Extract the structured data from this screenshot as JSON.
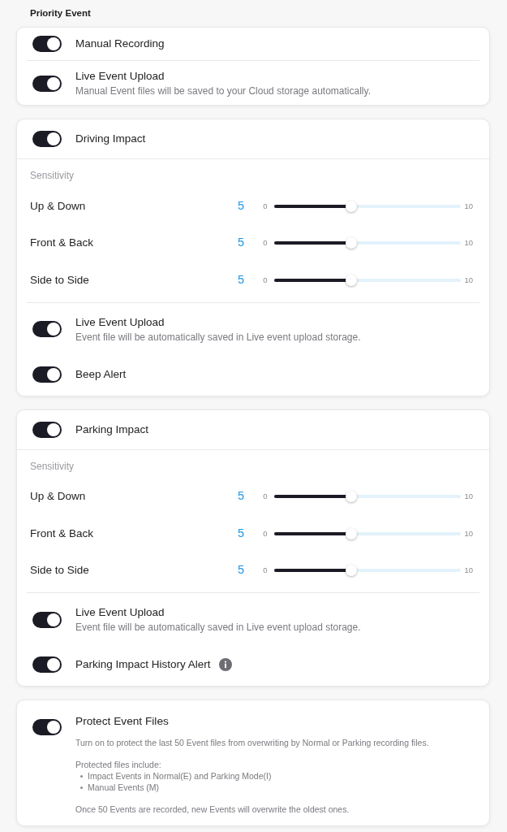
{
  "section_title": "Priority Event",
  "cards": [
    {
      "kind": "list",
      "rows": [
        {
          "label": "Manual Recording",
          "on": true,
          "info": false
        },
        {
          "label": "Live Event Upload",
          "description": "Manual Event files will be saved to your Cloud storage automatically.",
          "on": true,
          "info": false
        }
      ]
    },
    {
      "kind": "impact",
      "header": {
        "label": "Driving Impact",
        "on": true
      },
      "sensitivity": {
        "title": "Sensitivity",
        "sliders": [
          {
            "label": "Up & Down",
            "reading": "5",
            "min": "0",
            "max": "10",
            "level": 0.41
          },
          {
            "label": "Front & Back",
            "reading": "5",
            "min": "0",
            "max": "10",
            "level": 0.41
          },
          {
            "label": "Side to Side",
            "reading": "5",
            "min": "0",
            "max": "10",
            "level": 0.41
          }
        ]
      },
      "rows": [
        {
          "label": "Live Event Upload",
          "description": "Event file will be automatically saved in Live event upload storage.",
          "on": true,
          "info": false
        },
        {
          "label": "Beep Alert",
          "on": true,
          "info": false
        }
      ]
    },
    {
      "kind": "impact",
      "header": {
        "label": "Parking Impact",
        "on": true
      },
      "sensitivity": {
        "title": "Sensitivity",
        "sliders": [
          {
            "label": "Up & Down",
            "reading": "5",
            "min": "0",
            "max": "10",
            "level": 0.41
          },
          {
            "label": "Front & Back",
            "reading": "5",
            "min": "0",
            "max": "10",
            "level": 0.41
          },
          {
            "label": "Side to Side",
            "reading": "5",
            "min": "0",
            "max": "10",
            "level": 0.41
          }
        ]
      },
      "rows": [
        {
          "label": "Live Event Upload",
          "description": "Event file will be automatically saved in Live event upload storage.",
          "on": true,
          "info": false
        },
        {
          "label": "Parking Impact History Alert",
          "on": true,
          "info": true
        }
      ]
    },
    {
      "kind": "protect",
      "label": "Protect Event Files",
      "on": true,
      "description": "Turn on to protect the last 50 Event files from overwriting by Normal or Parking recording files.",
      "list_title": "Protected files include:",
      "list_items": [
        "Impact Events in Normal(E) and Parking Mode(I)",
        "Manual Events (M)"
      ],
      "note": "Once 50 Events are recorded, new Events will overwrite the oldest ones."
    }
  ]
}
